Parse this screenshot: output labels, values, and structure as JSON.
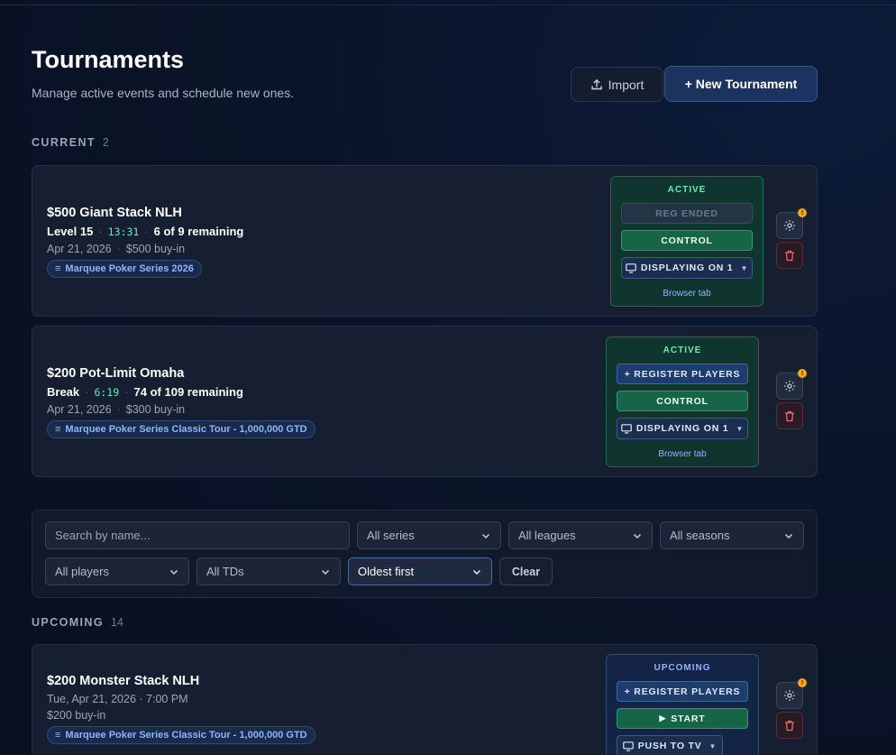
{
  "header": {
    "title": "Tournaments",
    "subtitle": "Manage active events and schedule new ones.",
    "import_label": "Import",
    "new_label": "+ New Tournament"
  },
  "current": {
    "label": "CURRENT",
    "count": "2",
    "items": [
      {
        "name": "$500 Giant Stack NLH",
        "level": "Level 15",
        "clock": "13:31",
        "remaining": "6 of 9 remaining",
        "date": "Apr 21, 2026",
        "buyin": "$500 buy-in",
        "series": "Marquee Poker Series 2026",
        "state": "ACTIVE",
        "reg_button": "REG ENDED",
        "control_button": "CONTROL",
        "display_button": "DISPLAYING ON 1",
        "browser_tab": "Browser tab"
      },
      {
        "name": "$200 Pot-Limit Omaha",
        "level": "Break",
        "clock": "6:19",
        "remaining": "74 of 109 remaining",
        "date": "Apr 21, 2026",
        "buyin": "$300 buy-in",
        "series": "Marquee Poker Series Classic Tour - 1,000,000 GTD",
        "state": "ACTIVE",
        "reg_button": "+ REGISTER PLAYERS",
        "control_button": "CONTROL",
        "display_button": "DISPLAYING ON 1",
        "browser_tab": "Browser tab"
      }
    ]
  },
  "filters": {
    "search_placeholder": "Search by name...",
    "series": "All series",
    "leagues": "All leagues",
    "seasons": "All seasons",
    "players": "All players",
    "tds": "All TDs",
    "sort": "Oldest first",
    "clear": "Clear"
  },
  "upcoming": {
    "label": "UPCOMING",
    "count": "14",
    "items": [
      {
        "name": "$200 Monster Stack NLH",
        "datetime": "Tue, Apr 21, 2026 · 7:00 PM",
        "buyin": "$200 buy-in",
        "series": "Marquee Poker Series Classic Tour - 1,000,000 GTD",
        "state": "UPCOMING",
        "reg_button": "+ REGISTER PLAYERS",
        "start_button": "START",
        "push_button": "PUSH TO TV"
      }
    ]
  },
  "badge_glyph": "!"
}
